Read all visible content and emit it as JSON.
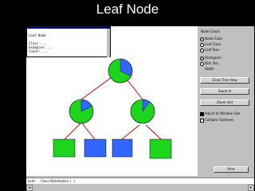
{
  "slide": {
    "title": "Leaf Node"
  },
  "popup": {
    "title": "Leaf Node",
    "lines": [
      "Class ... ",
      "Examples: ...",
      "Count: ..."
    ]
  },
  "colors": {
    "blue": "#3366ff",
    "green": "#1ed51e",
    "edge": "#cc0000",
    "title_bar": "#000080"
  },
  "tree": {
    "root": {
      "blue_fraction": 0.3
    },
    "left_child": {
      "blue_fraction": 0.3
    },
    "right_child": {
      "blue_fraction": 0.1
    },
    "leaves": [
      "green",
      "blue",
      "blue",
      "green"
    ]
  },
  "panel": {
    "header": "Node Colors",
    "options": [
      "Node Class",
      "Leaf Class",
      "Leaf Size",
      "Histogram",
      "Dist. Bar",
      "Width"
    ],
    "buttons": [
      "Close Tree View",
      "Zoom In",
      "Zoom Out",
      "Print"
    ],
    "checks": [
      "Adjust to Window Size",
      "Collapse Subtrees"
    ]
  },
  "status": {
    "text": "Leaf: ... Class Distribution (...)"
  }
}
